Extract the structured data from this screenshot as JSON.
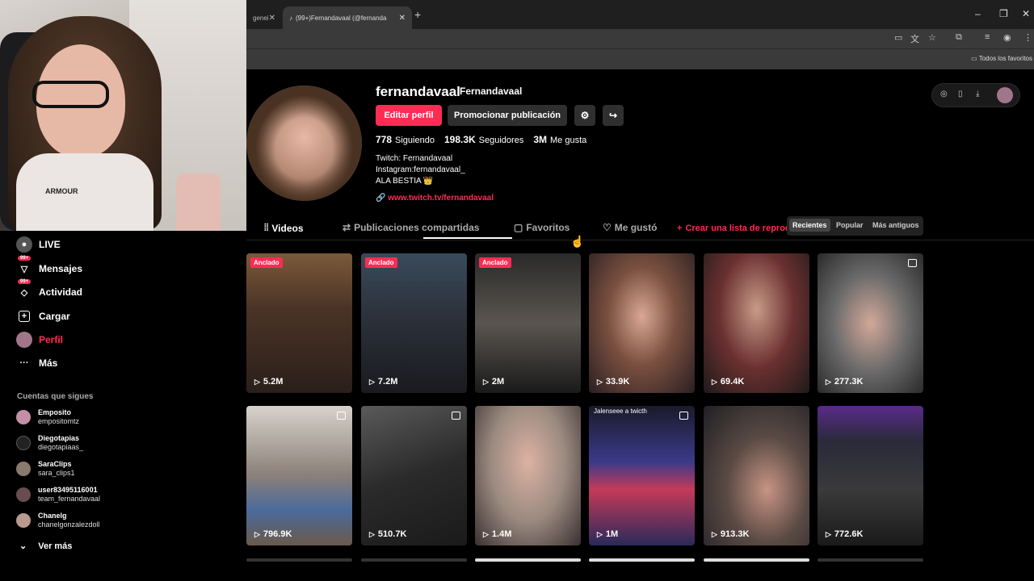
{
  "browser": {
    "tab_inactive": "genei",
    "tab_active": "(99+)Fernandavaal (@fernanda",
    "bookmarks_folder": "Todos los favoritos"
  },
  "sidebar": {
    "items": [
      {
        "label": "LIVE",
        "icon": "live-icon"
      },
      {
        "label": "Mensajes",
        "icon": "messages-icon",
        "badge": "99+"
      },
      {
        "label": "Actividad",
        "icon": "activity-icon",
        "badge": "99+"
      },
      {
        "label": "Cargar",
        "icon": "upload-icon"
      },
      {
        "label": "Perfil",
        "icon": "profile-icon"
      },
      {
        "label": "Más",
        "icon": "more-icon"
      }
    ],
    "following_title": "Cuentas que sigues",
    "following": [
      {
        "name": "Emposito",
        "user": "empositomtz"
      },
      {
        "name": "Diegotapias",
        "user": "diegotapiaas_"
      },
      {
        "name": "SaraClips",
        "user": "sara_clips1"
      },
      {
        "name": "user83495116001",
        "user": "team_fernandavaal"
      },
      {
        "name": "Chanelg",
        "user": "chanelgonzalezdoll"
      }
    ],
    "see_more": "Ver más"
  },
  "profile": {
    "username": "fernandavaal",
    "nickname": "Fernandavaal",
    "edit_button": "Editar perfil",
    "promote_button": "Promocionar publicación",
    "following_count": "778",
    "following_label": "Siguiendo",
    "followers_count": "198.3K",
    "followers_label": "Seguidores",
    "likes_count": "3M",
    "likes_label": "Me gusta",
    "bio_line1": "Twitch: Fernandavaal",
    "bio_line2": "Instagram:fernandavaal_",
    "bio_line3": "ALA BESTIA 👑",
    "link": "www.twitch.tv/fernandavaal"
  },
  "tabs": {
    "videos": "Videos",
    "reposts": "Publicaciones compartidas",
    "favorites": "Favoritos",
    "liked": "Me gustó",
    "create_playlist": "Crear una lista de reprod",
    "sort_recent": "Recientes",
    "sort_popular": "Popular",
    "sort_oldest": "Más antiguos"
  },
  "videos": [
    {
      "views": "5.2M",
      "pinned": "Anclado"
    },
    {
      "views": "7.2M",
      "pinned": "Anclado"
    },
    {
      "views": "2M",
      "pinned": "Anclado"
    },
    {
      "views": "33.9K"
    },
    {
      "views": "69.4K"
    },
    {
      "views": "277.3K"
    },
    {
      "views": "796.9K"
    },
    {
      "views": "510.7K"
    },
    {
      "views": "1.4M"
    },
    {
      "views": "1M",
      "caption": "Jalenseee a twicth"
    },
    {
      "views": "913.3K"
    },
    {
      "views": "772.6K"
    }
  ],
  "colors": {
    "accent": "#fe2c55"
  }
}
